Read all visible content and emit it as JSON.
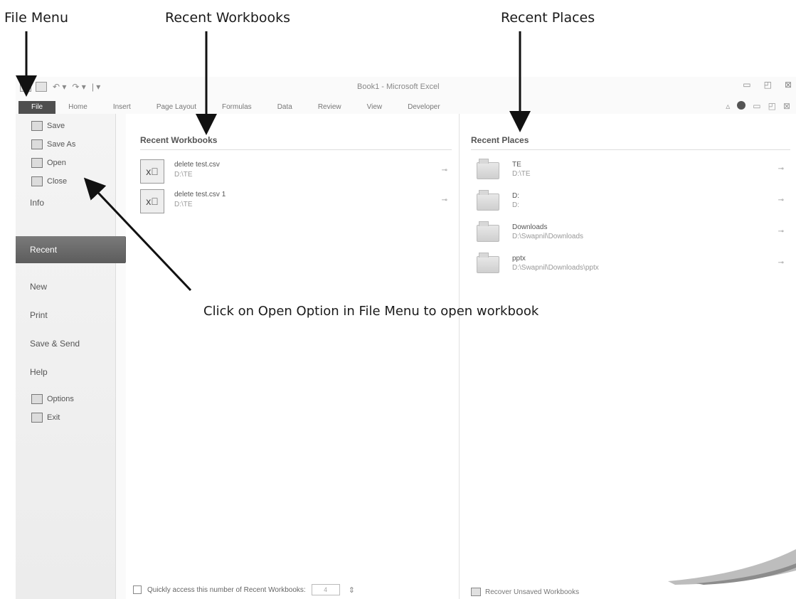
{
  "annotations": {
    "file_menu": "File Menu",
    "recent_workbooks": "Recent Workbooks",
    "recent_places": "Recent Places",
    "note": "Click  on Open Option in File Menu to open workbook"
  },
  "window": {
    "title": "Book1 - Microsoft Excel",
    "tabs": [
      "File",
      "Home",
      "Insert",
      "Page Layout",
      "Formulas",
      "Data",
      "Review",
      "View",
      "Developer"
    ]
  },
  "menu": {
    "save": "Save",
    "save_as": "Save As",
    "open": "Open",
    "close": "Close",
    "info": "Info",
    "recent": "Recent",
    "new": "New",
    "print": "Print",
    "save_send": "Save & Send",
    "help": "Help",
    "options": "Options",
    "exit": "Exit"
  },
  "recent_workbooks": {
    "heading": "Recent Workbooks",
    "items": [
      {
        "name": "delete test.csv",
        "path": "D:\\TE"
      },
      {
        "name": "delete test.csv 1",
        "path": "D:\\TE"
      }
    ],
    "quick_access_label": "Quickly access this number of Recent Workbooks:",
    "quick_access_value": "4"
  },
  "recent_places": {
    "heading": "Recent Places",
    "items": [
      {
        "name": "TE",
        "path": "D:\\TE"
      },
      {
        "name": "D:",
        "path": "D:"
      },
      {
        "name": "Downloads",
        "path": "D:\\Swapnil\\Downloads"
      },
      {
        "name": "pptx",
        "path": "D:\\Swapnil\\Downloads\\pptx"
      }
    ],
    "recover_label": "Recover Unsaved Workbooks"
  },
  "icons": {
    "arrow": "arrow-icon",
    "pin": "pin-icon",
    "folder": "folder-icon",
    "excel_file": "excel-file-icon"
  }
}
